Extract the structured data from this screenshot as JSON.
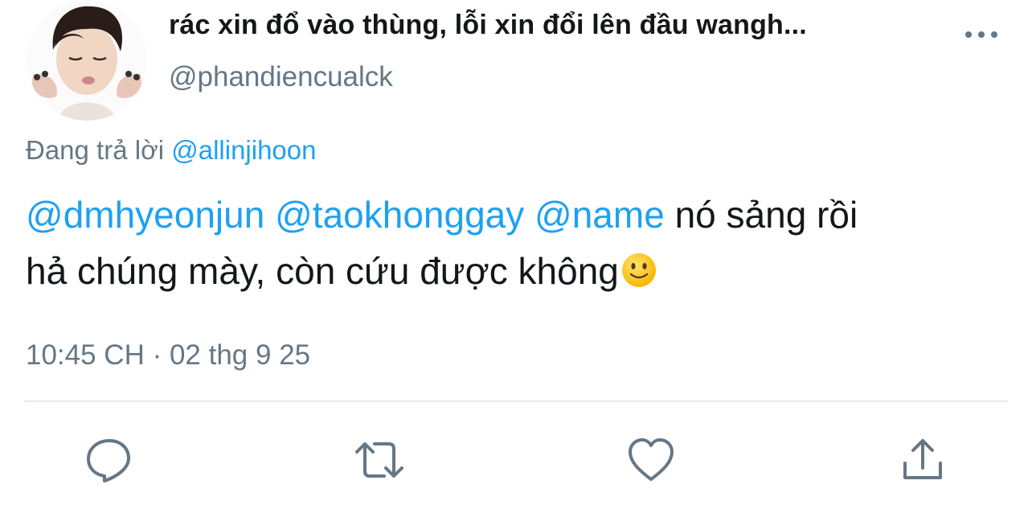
{
  "tweet": {
    "display_name": "rác xin đổ vào thùng, lỗi xin đổi lên đầu wangh...",
    "handle": "@phandiencualck",
    "reply_prefix": "Đang trả lời",
    "reply_to": "@allinjihoon",
    "mentions": [
      "@dmhyeonjun",
      "@taokhonggay",
      "@name"
    ],
    "body_line1": "nó sảng rồi",
    "body_line2": "hả chúng mày, còn cứu được không",
    "emoji": "slightly-smiling-face",
    "timestamp": "10:45 CH · 02 thg 9 25"
  },
  "actions": {
    "icons": [
      "reply-icon",
      "retweet-icon",
      "like-icon",
      "share-icon"
    ]
  },
  "colors": {
    "link": "#1da1f2",
    "secondary_text": "#657786",
    "primary_text": "#14171a",
    "divider": "#e6ecf0"
  }
}
